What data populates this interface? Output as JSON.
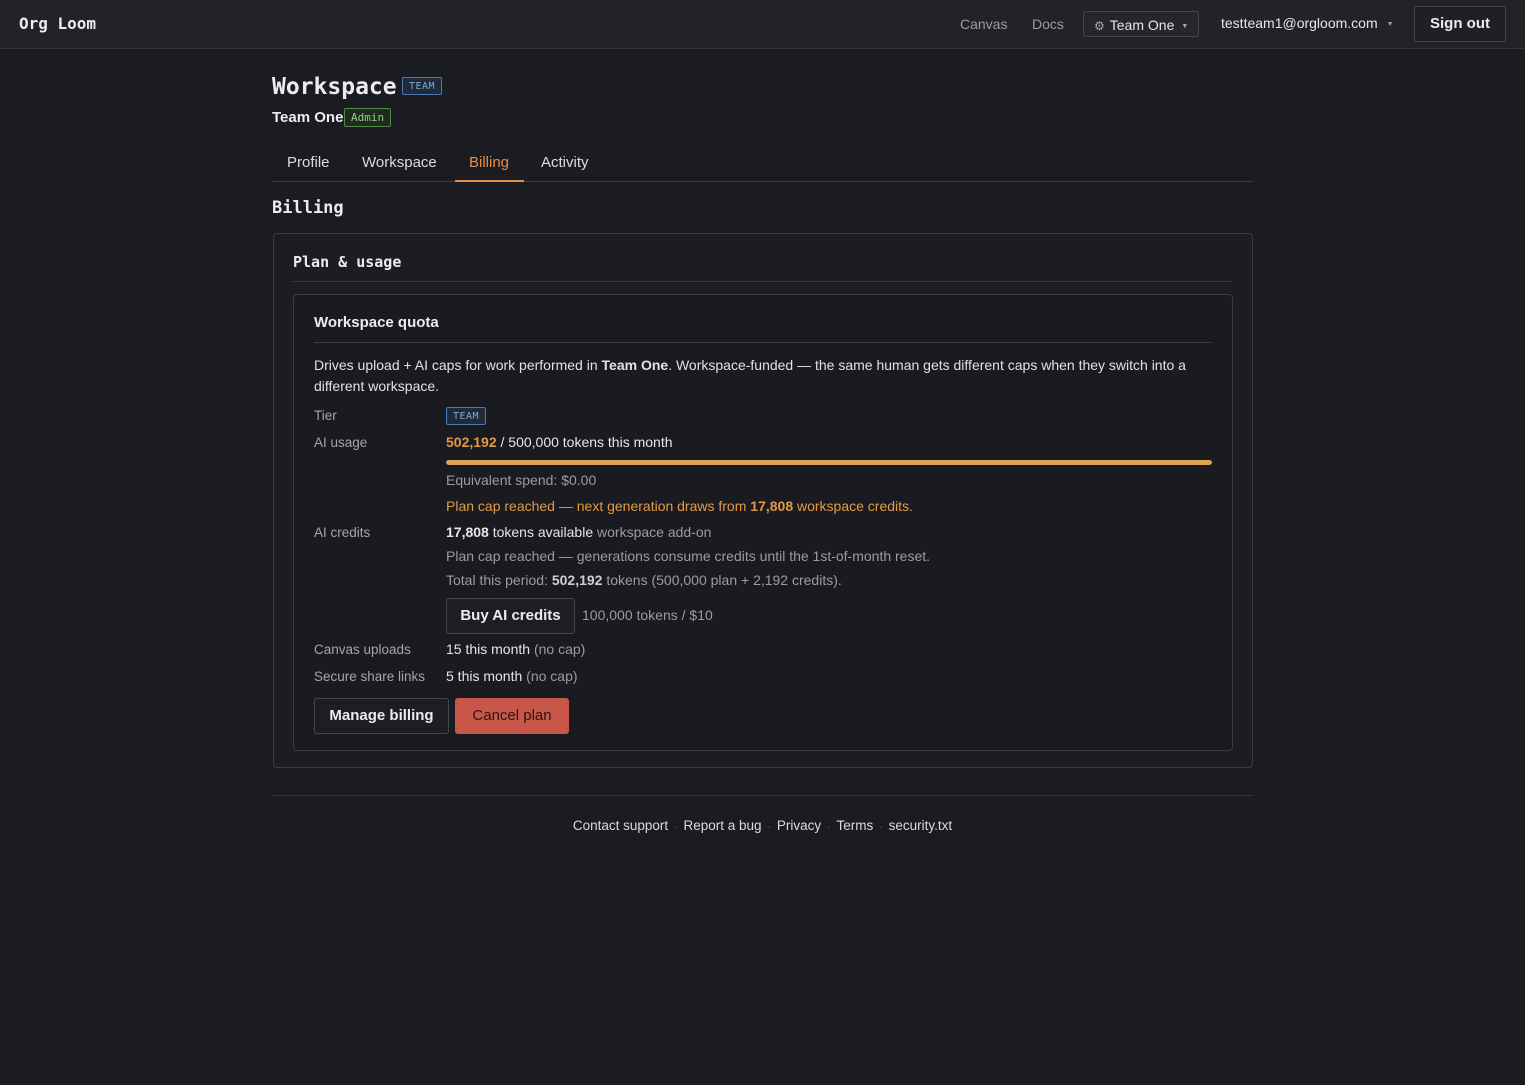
{
  "header": {
    "brand": "Org Loom",
    "nav": {
      "canvas": "Canvas",
      "docs": "Docs"
    },
    "team_select": "Team One",
    "user_email": "testteam1@orgloom.com",
    "sign_out": "Sign out"
  },
  "page": {
    "title": "Workspace",
    "title_badge": "TEAM",
    "team_name": "Team One",
    "role_badge": "Admin",
    "tabs": [
      {
        "label": "Profile"
      },
      {
        "label": "Workspace"
      },
      {
        "label": "Billing"
      },
      {
        "label": "Activity"
      }
    ],
    "active_tab": "Billing",
    "section_title": "Billing"
  },
  "plan": {
    "panel_title": "Plan & usage",
    "card_title": "Workspace quota",
    "description": {
      "pre": "Drives upload + AI caps for work performed in ",
      "team": "Team One",
      "post": ". Workspace-funded — the same human gets different caps when they switch into a different workspace."
    },
    "tier": {
      "label": "Tier",
      "badge": "TEAM"
    },
    "ai_usage": {
      "label": "AI usage",
      "used": "502,192",
      "rest": " / 500,000 tokens this month",
      "progress_fraction": 1.0,
      "equivalent_spend": "Equivalent spend: $0.00",
      "cap_warning_pre": "Plan cap reached — next generation draws from ",
      "cap_warning_credits": "17,808",
      "cap_warning_post": " workspace credits."
    },
    "ai_credits": {
      "label": "AI credits",
      "amount": "17,808",
      "amount_suffix": " tokens available",
      "addon": " workspace add-on",
      "note": "Plan cap reached — generations consume credits until the 1st-of-month reset.",
      "total_pre": "Total this period: ",
      "total_value": "502,192",
      "total_post": " tokens (500,000 plan + 2,192 credits).",
      "buy_button": "Buy AI credits",
      "buy_price": "100,000 tokens / $10"
    },
    "canvas_uploads": {
      "label": "Canvas uploads",
      "value": "15 this month",
      "cap": " (no cap)"
    },
    "share_links": {
      "label": "Secure share links",
      "value": "5 this month",
      "cap": " (no cap)"
    },
    "manage_billing": "Manage billing",
    "cancel_plan": "Cancel plan"
  },
  "footer": {
    "links": [
      "Contact support",
      "Report a bug",
      "Privacy",
      "Terms",
      "security.txt"
    ]
  },
  "colors": {
    "accent": "#e38f4a",
    "progress": "#d9a552",
    "danger": "#c8574a",
    "badge_blue": "#82a8d8",
    "badge_green": "#8fd07f"
  }
}
